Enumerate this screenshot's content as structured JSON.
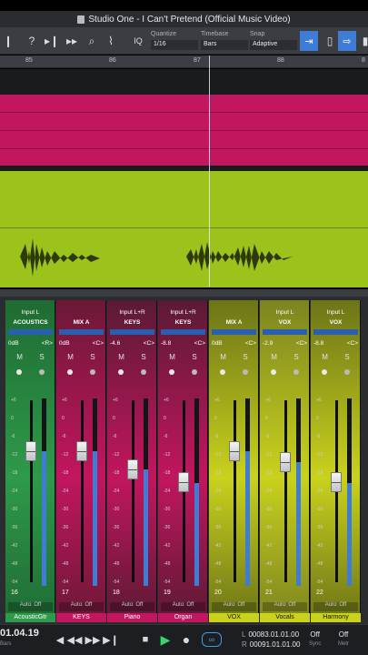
{
  "window": {
    "title": "Studio One - I Can't Pretend (Official Music Video)"
  },
  "toolbar": {
    "quantize": {
      "label": "Quantize",
      "value": "1/16"
    },
    "timebase": {
      "label": "Timebase",
      "value": "Bars"
    },
    "snap": {
      "label": "Snap",
      "value": "Adaptive"
    },
    "iq_label": "IQ"
  },
  "ruler": {
    "bars": [
      "85",
      "86",
      "87",
      "88"
    ]
  },
  "mixer": {
    "channels": [
      {
        "input": "Input L",
        "output": "ACOUSTICS",
        "vol": "0dB",
        "pan": "<R>",
        "num": "16",
        "name": "AcousticGtr",
        "color": "#2e9a4a",
        "dark": "#1f6b33",
        "level": 0.72
      },
      {
        "input": "",
        "output": "MIX A",
        "vol": "0dB",
        "pan": "<C>",
        "num": "17",
        "name": "KEYS",
        "color": "#c2165e",
        "dark": "#6b1836",
        "level": 0.72
      },
      {
        "input": "Input L+R",
        "output": "KEYS",
        "vol": "-4.6",
        "pan": "<C>",
        "num": "18",
        "name": "Piano",
        "color": "#c2165e",
        "dark": "#5a1a34",
        "level": 0.62
      },
      {
        "input": "Input L+R",
        "output": "KEYS",
        "vol": "-8.8",
        "pan": "<C>",
        "num": "19",
        "name": "Organ",
        "color": "#c2165e",
        "dark": "#5a1a34",
        "level": 0.55
      },
      {
        "input": "",
        "output": "MIX A",
        "vol": "0dB",
        "pan": "<C>",
        "num": "20",
        "name": "VOX",
        "color": "#c9d21c",
        "dark": "#6c7418",
        "level": 0.72
      },
      {
        "input": "Input L",
        "output": "VOX",
        "vol": "-2.9",
        "pan": "<C>",
        "num": "21",
        "name": "Vocals",
        "color": "#c9d21c",
        "dark": "#7c8420",
        "level": 0.66
      },
      {
        "input": "Input L",
        "output": "VOX",
        "vol": "-8.8",
        "pan": "<C>",
        "num": "22",
        "name": "Harmony",
        "color": "#c9d21c",
        "dark": "#6c7418",
        "level": 0.55
      }
    ],
    "automation_label": "Auto: Off",
    "mute_label": "M",
    "solo_label": "S",
    "scale": [
      "+6",
      "0",
      "-6",
      "-12",
      "-18",
      "-24",
      "-30",
      "-36",
      "-42",
      "-48",
      "-54"
    ]
  },
  "transport": {
    "time": "01.04.19",
    "time_sub": "Bars",
    "l_label": "L",
    "r_label": "R",
    "left_locator": "00083.01.01.00",
    "right_locator": "00091.01.01.00",
    "sync": {
      "value": "Off",
      "label": "Sync"
    },
    "metronome": {
      "value": "Off",
      "label": "Metr"
    }
  }
}
